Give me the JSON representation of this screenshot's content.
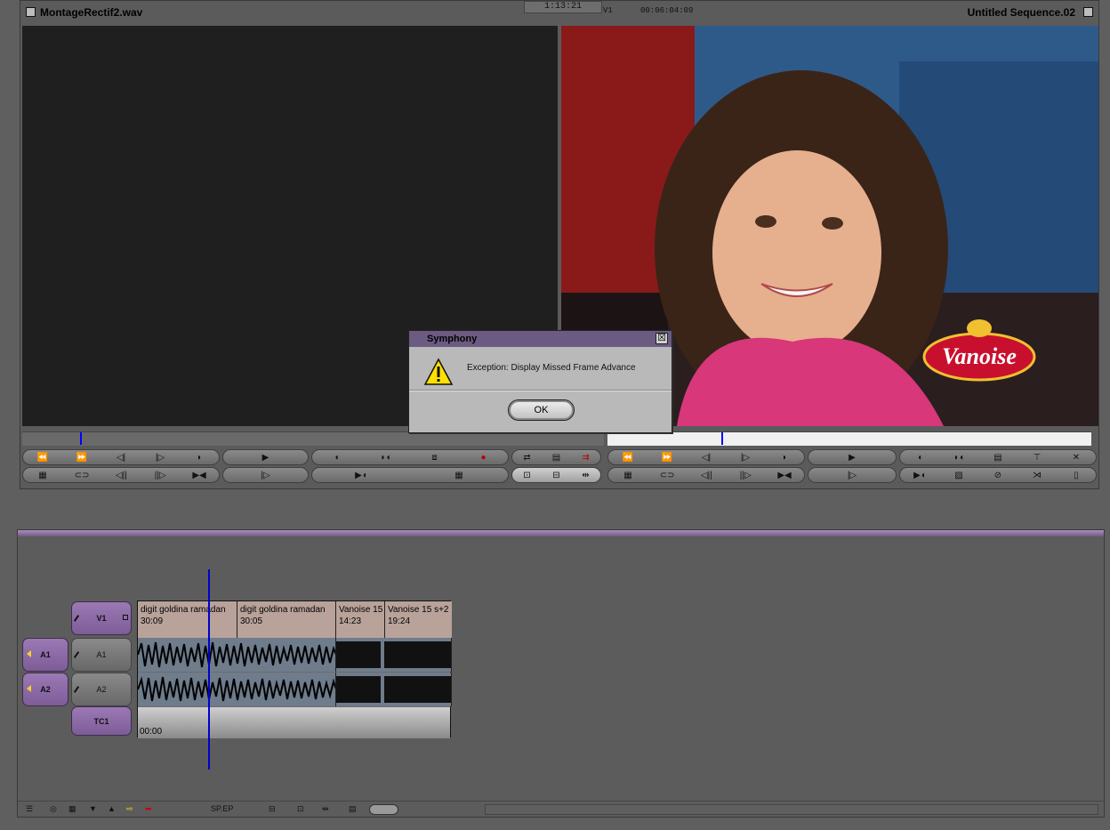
{
  "composer": {
    "source_title": "MontageRectif2.wav",
    "record_title": "Untitled Sequence.02",
    "center_timecode": "1:13:21",
    "src_tc_label": "V1",
    "src_tc_value": "00:06:04:09"
  },
  "source_buttons_row1": [
    "⏪",
    "⏩",
    "◁|",
    "|▷",
    "◗",
    "▶",
    "◖",
    "◗◖",
    "⧈",
    "●",
    "⇄",
    "▤",
    "⇉"
  ],
  "source_buttons_row2": [
    "▦",
    "⊂⊃",
    "◁||",
    "||▷",
    "▶◀",
    "|▷",
    "▶◖",
    "▦",
    "⊡",
    "⊟",
    "⇹"
  ],
  "record_buttons_row1": [
    "⏪",
    "⏩",
    "◁|",
    "|▷",
    "◗",
    "▶",
    "◖",
    "◗◖",
    "▤",
    "⊤",
    "✕"
  ],
  "record_buttons_row2": [
    "▦",
    "⊂⊃",
    "◁||",
    "||▷",
    "▶◀",
    "|▷",
    "▶◖",
    "▨",
    "⊘",
    "⋊",
    "▯"
  ],
  "dialog": {
    "title": "Symphony",
    "close_label": "☒",
    "message": "Exception: Display Missed Frame Advance",
    "ok_label": "OK"
  },
  "tracks": {
    "v1": "V1",
    "a1_src": "A1",
    "a2_src": "A2",
    "a1_rec": "A1",
    "a2_rec": "A2",
    "tc1": "TC1"
  },
  "video_clips": [
    {
      "name": "digit goldina ramadan",
      "duration": "30:09"
    },
    {
      "name": "digit goldina ramadan",
      "duration": "30:05"
    },
    {
      "name": "Vanoise 15",
      "duration": "14:23"
    },
    {
      "name": "Vanoise 15 s+2",
      "duration": "19:24"
    }
  ],
  "timecode_start": "00:00",
  "timeline_bottom": {
    "spep_label": "SP.EP"
  },
  "brand": {
    "logo_text": "Vanoise",
    "logo_color": "#c8102e",
    "accent_purple": "#6b5b82"
  }
}
